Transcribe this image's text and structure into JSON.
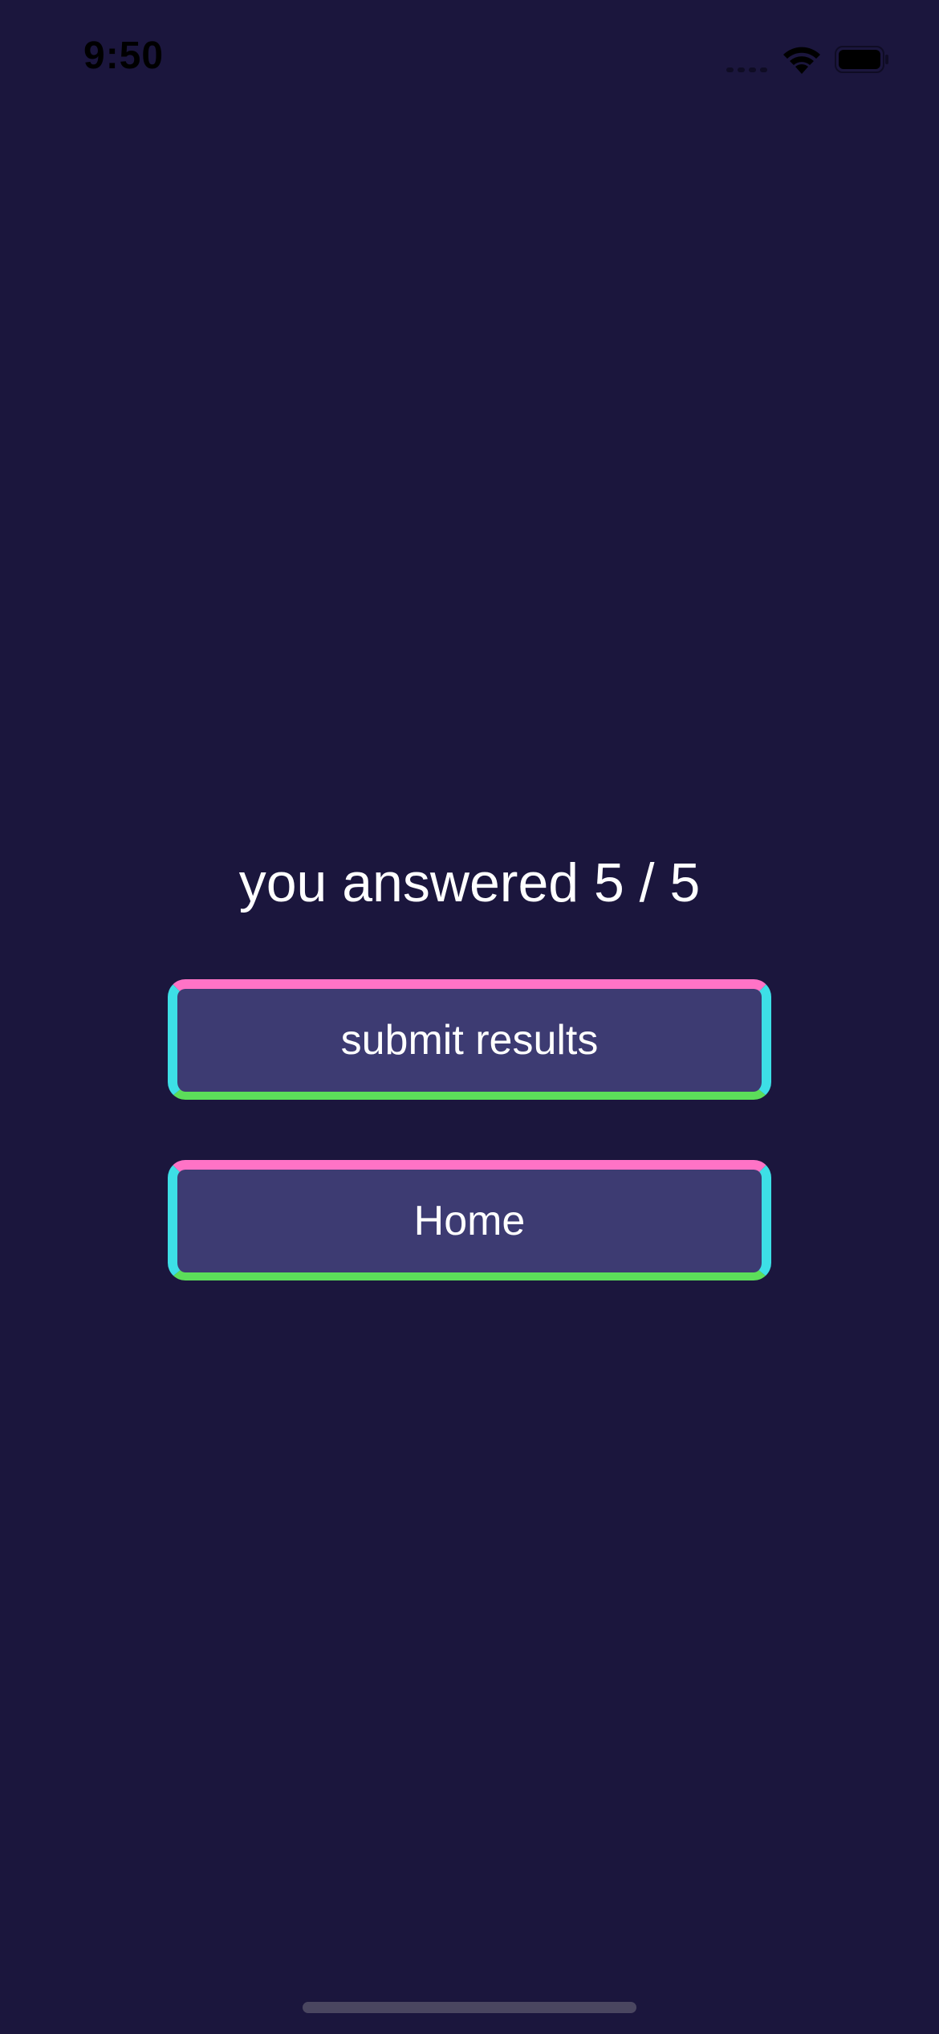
{
  "status_bar": {
    "time": "9:50",
    "icons": [
      "cellular-signal-icon",
      "wifi-icon",
      "battery-icon"
    ]
  },
  "result": {
    "score_text": "you answered 5 / 5"
  },
  "actions": {
    "submit_label": "submit results",
    "home_label": "Home"
  },
  "colors": {
    "background": "#1b163d",
    "button_fill": "#3d3b72",
    "border_top": "#ff73c6",
    "border_sides": "#3ddfe6",
    "border_bottom": "#5cde5a",
    "text": "#ffffff"
  }
}
